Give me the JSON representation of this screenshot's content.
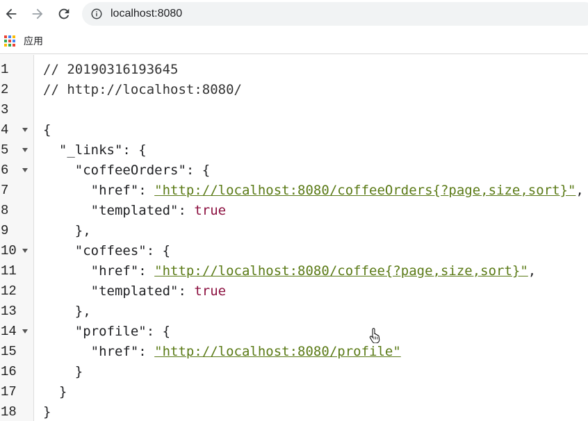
{
  "browser": {
    "url": "localhost:8080",
    "bookmarks": {
      "apps_label": "应用"
    }
  },
  "editor": {
    "lines": [
      {
        "n": "1",
        "fold": false,
        "indent": "",
        "kind": "comment",
        "text": "// 20190316193645"
      },
      {
        "n": "2",
        "fold": false,
        "indent": "",
        "kind": "comment",
        "text": "// http://localhost:8080/"
      },
      {
        "n": "3",
        "fold": false,
        "indent": "",
        "kind": "plain",
        "text": ""
      },
      {
        "n": "4",
        "fold": true,
        "indent": "",
        "kind": "plain",
        "text": "{"
      },
      {
        "n": "5",
        "fold": true,
        "indent": "  ",
        "kind": "plain",
        "text": "\"_links\": {"
      },
      {
        "n": "6",
        "fold": true,
        "indent": "    ",
        "kind": "plain",
        "text": "\"coffeeOrders\": {"
      },
      {
        "n": "7",
        "fold": false,
        "indent": "      ",
        "kind": "link",
        "key": "\"href\": ",
        "value": "\"http://localhost:8080/coffeeOrders{?page,size,sort}\"",
        "tail": ","
      },
      {
        "n": "8",
        "fold": false,
        "indent": "      ",
        "kind": "bool",
        "key": "\"templated\": ",
        "value": "true",
        "tail": ""
      },
      {
        "n": "9",
        "fold": false,
        "indent": "    ",
        "kind": "plain",
        "text": "},"
      },
      {
        "n": "10",
        "fold": true,
        "indent": "    ",
        "kind": "plain",
        "text": "\"coffees\": {"
      },
      {
        "n": "11",
        "fold": false,
        "indent": "      ",
        "kind": "link",
        "key": "\"href\": ",
        "value": "\"http://localhost:8080/coffee{?page,size,sort}\"",
        "tail": ","
      },
      {
        "n": "12",
        "fold": false,
        "indent": "      ",
        "kind": "bool",
        "key": "\"templated\": ",
        "value": "true",
        "tail": ""
      },
      {
        "n": "13",
        "fold": false,
        "indent": "    ",
        "kind": "plain",
        "text": "},"
      },
      {
        "n": "14",
        "fold": true,
        "indent": "    ",
        "kind": "plain",
        "text": "\"profile\": {"
      },
      {
        "n": "15",
        "fold": false,
        "indent": "      ",
        "kind": "link",
        "key": "\"href\": ",
        "value": "\"http://localhost:8080/profile\"",
        "tail": ""
      },
      {
        "n": "16",
        "fold": false,
        "indent": "    ",
        "kind": "plain",
        "text": "}"
      },
      {
        "n": "17",
        "fold": false,
        "indent": "  ",
        "kind": "plain",
        "text": "}"
      },
      {
        "n": "18",
        "fold": false,
        "indent": "",
        "kind": "plain",
        "text": "}"
      }
    ]
  },
  "colors": {
    "link": "#5a7a16",
    "boolean": "#8b0f3f",
    "gutter_bg": "#f7f7f7"
  },
  "icons": {
    "back": "arrow-left-icon",
    "forward": "arrow-right-icon",
    "reload": "reload-icon",
    "site_info": "info-icon",
    "apps": "apps-grid-icon",
    "fold": "fold-triangle-icon",
    "cursor": "hand-pointer-icon"
  }
}
